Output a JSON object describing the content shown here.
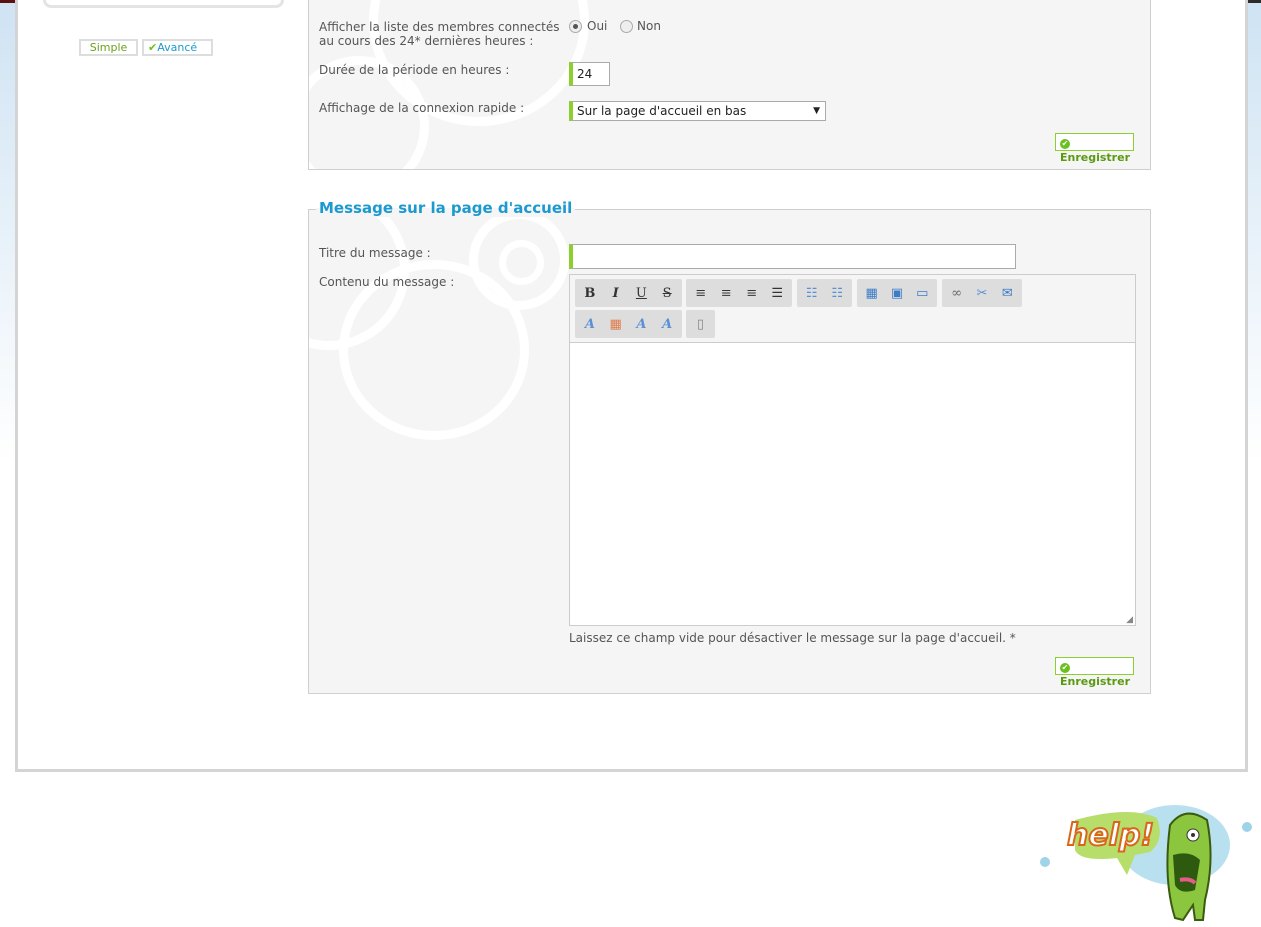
{
  "sidebar": {
    "simple_label": "Simple",
    "advanced_label": "Avancé"
  },
  "online": {
    "members_label_1": "Afficher la liste des membres connectés",
    "members_label_2": "au cours des 24* dernières heures :",
    "yes": "Oui",
    "no": "Non",
    "selected": "Oui",
    "duration_label": "Durée de la période en heures :",
    "duration_value": "24",
    "quick_login_label": "Affichage de la connexion rapide :",
    "quick_login_value": "Sur la page d'accueil en bas",
    "save_label": "Enregistrer"
  },
  "message": {
    "legend": "Message sur la page d'accueil",
    "title_label": "Titre du message :",
    "title_value": "",
    "content_label": "Contenu du message :",
    "content_value": "",
    "hint": "Laissez ce champ vide pour désactiver le message sur la page d'accueil. *",
    "save_label": "Enregistrer",
    "toolbar": {
      "bold": "B",
      "italic": "I",
      "underline": "U",
      "strike": "S"
    }
  },
  "colors": {
    "accent": "#8ccf2e",
    "legend": "#1c9ad0"
  },
  "logo": {
    "text": "help!"
  }
}
